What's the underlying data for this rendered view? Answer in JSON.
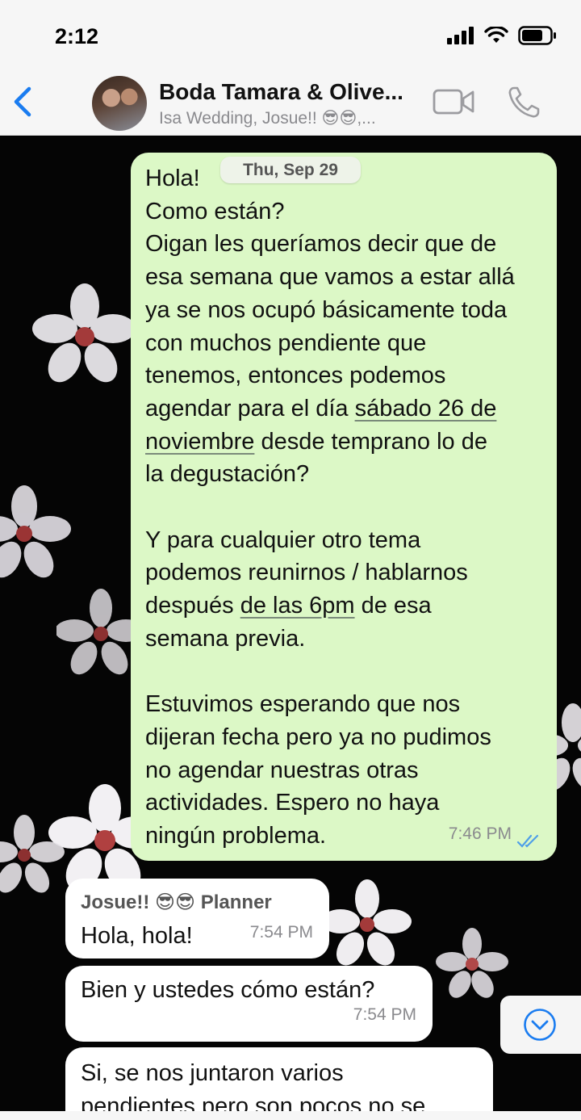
{
  "status_bar": {
    "time": "2:12"
  },
  "header": {
    "title": "Boda Tamara & Olive...",
    "subtitle": "Isa Wedding, Josue!! 😎😎,..."
  },
  "chat": {
    "date_pill": "Thu, Sep 29",
    "outgoing": {
      "lines": [
        "Hola!",
        "Como están?",
        "Oigan les queríamos decir que de",
        "esa semana que vamos a estar allá",
        "ya se nos ocupó básicamente toda",
        "con muchos pendiente que",
        "tenemos, entonces podemos",
        "agendar para el día sábado 26 de",
        "noviembre desde temprano lo de",
        "la degustación?",
        "",
        "Y para cualquier otro tema",
        "podemos reunirnos / hablarnos",
        "después de las 6pm de esa",
        "semana previa.",
        "",
        "Estuvimos esperando que nos",
        "dijeran fecha pero ya no pudimos",
        "no agendar nuestras otras",
        "actividades. Espero no haya",
        "ningún problema."
      ],
      "link_parts": {
        "line8_pre": "agendar para el día ",
        "line8_link": "sábado 26 de",
        "line9_link": "noviembre",
        "line9_post": " desde temprano lo de",
        "line14_pre": "después ",
        "line14_link": "de las 6pm",
        "line14_post": " de esa"
      },
      "time": "7:46 PM",
      "status": "read"
    },
    "incoming": [
      {
        "sender": "Josue!! 😎😎 Planner",
        "text": "Hola, hola!",
        "time": "7:54 PM"
      },
      {
        "text": "Bien y ustedes cómo están?",
        "time": "7:54 PM"
      },
      {
        "text_lines": [
          "Si, se nos juntaron varios",
          "pendientes pero son pocos no se"
        ]
      }
    ]
  },
  "icons": [
    "back-chevron-icon",
    "video-call-icon",
    "phone-icon",
    "signal-icon",
    "wifi-icon",
    "battery-icon",
    "read-receipt-icon",
    "scroll-down-icon"
  ],
  "colors": {
    "accent": "#1a7cf0",
    "outgoing_bubble": "#dcf8c6",
    "incoming_bubble": "#ffffff",
    "wallpaper": "#050505"
  }
}
